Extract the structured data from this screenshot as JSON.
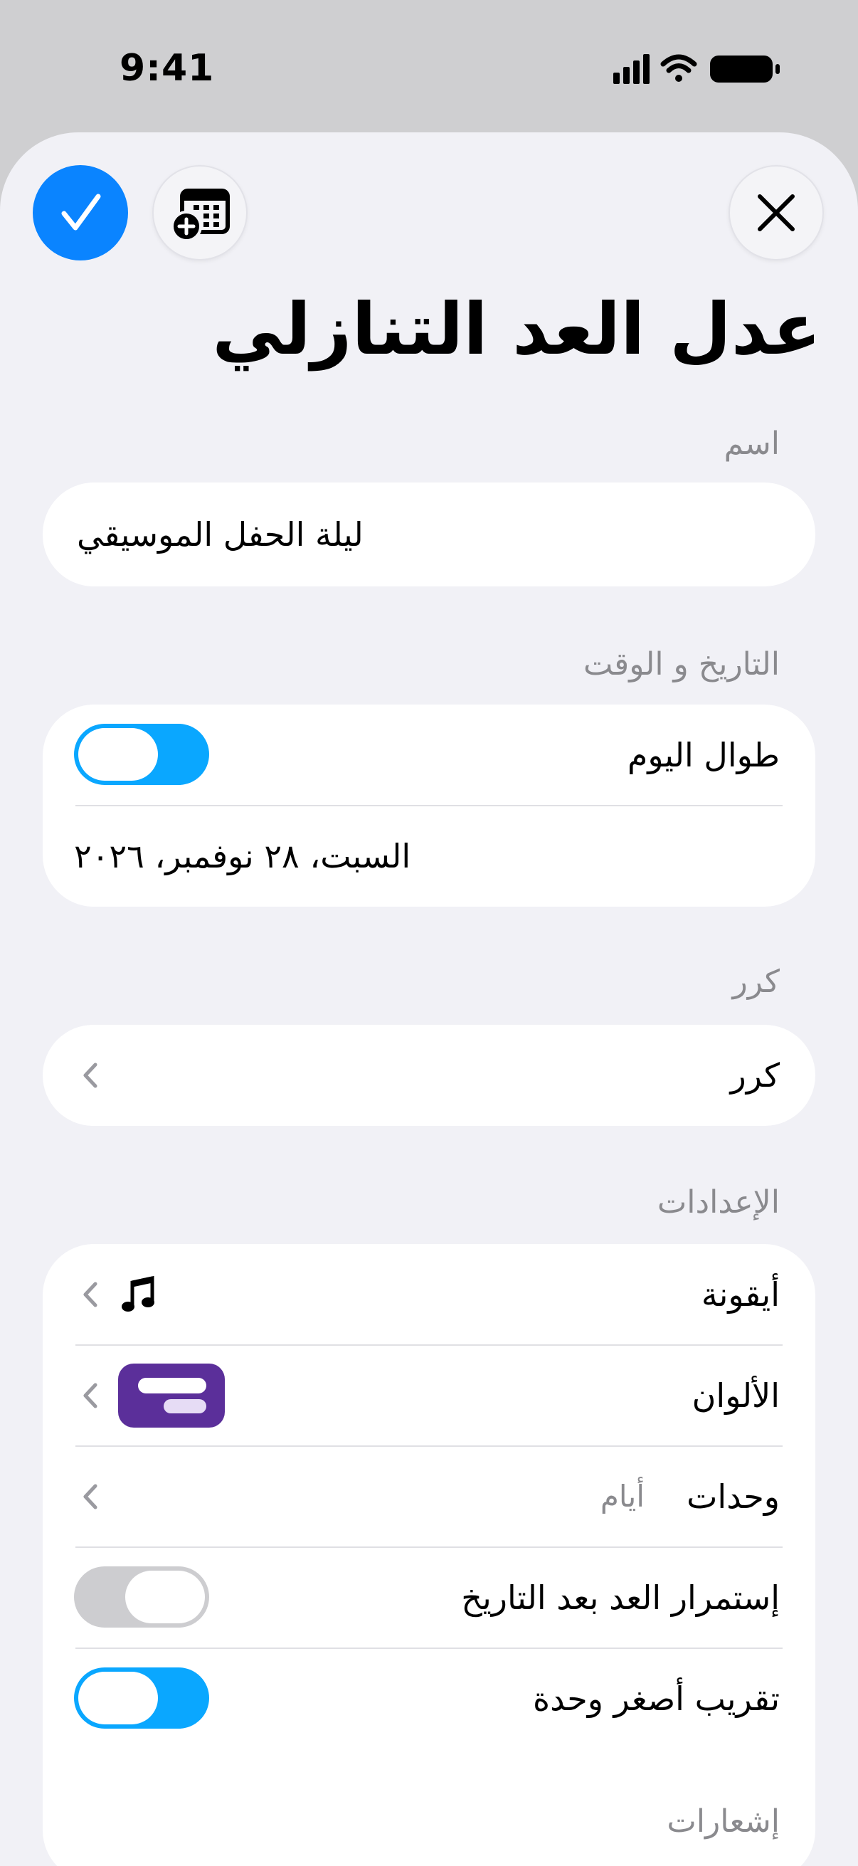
{
  "status_bar": {
    "time": "9:41"
  },
  "header": {
    "title": "عدل العد التنازلي",
    "accent_color": "#0a84ff"
  },
  "sections": {
    "name": {
      "header": "اسم",
      "value": "ليلة الحفل الموسيقي"
    },
    "datetime": {
      "header": "التاريخ و الوقت",
      "all_day_label": "طوال اليوم",
      "all_day_on": true,
      "date_value": "السبت، ٢٨ نوفمبر، ٢٠٢٦"
    },
    "repeat": {
      "header": "كرر",
      "row_label": "كرر"
    },
    "settings": {
      "header": "الإعدادات",
      "icon_label": "أيقونة",
      "icon_name": "music-note",
      "colors_label": "الألوان",
      "color_swatch": "#5b2f9a",
      "units_label": "وحدات",
      "units_value": "أيام",
      "continue_label": "إستمرار العد بعد التاريخ",
      "continue_on": false,
      "round_label": "تقريب أصغر وحدة",
      "round_on": true
    },
    "notifications": {
      "header": "إشعارات"
    }
  }
}
